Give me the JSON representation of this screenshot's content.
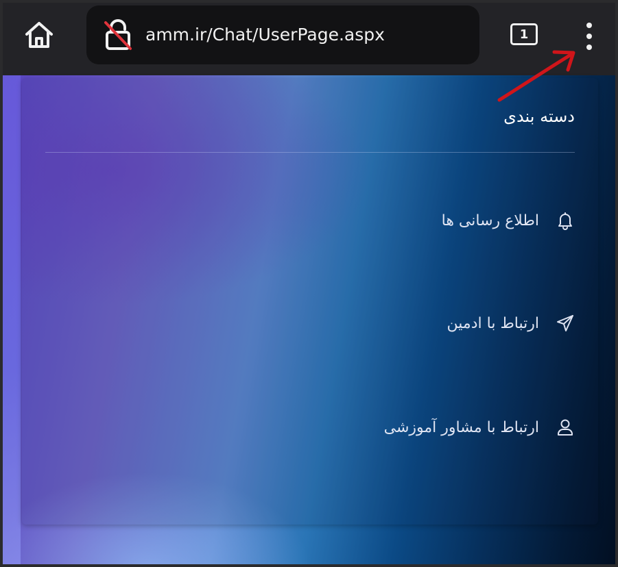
{
  "browser": {
    "url": "amm.ir/Chat/UserPage.aspx",
    "tab_count": "1",
    "icons": {
      "home": "home-icon",
      "lock": "lock-not-secure-icon",
      "tabs": "tab-switcher-icon",
      "menu": "more-vertical-icon"
    }
  },
  "panel": {
    "title": "دسته بندی",
    "items": [
      {
        "label": "اطلاع رسانی ها",
        "icon": "bell-icon"
      },
      {
        "label": "ارتباط با ادمین",
        "icon": "send-icon"
      },
      {
        "label": "ارتباط با مشاور آموزشی",
        "icon": "user-icon"
      }
    ]
  },
  "annotation": {
    "arrow_color": "#d0151a"
  }
}
